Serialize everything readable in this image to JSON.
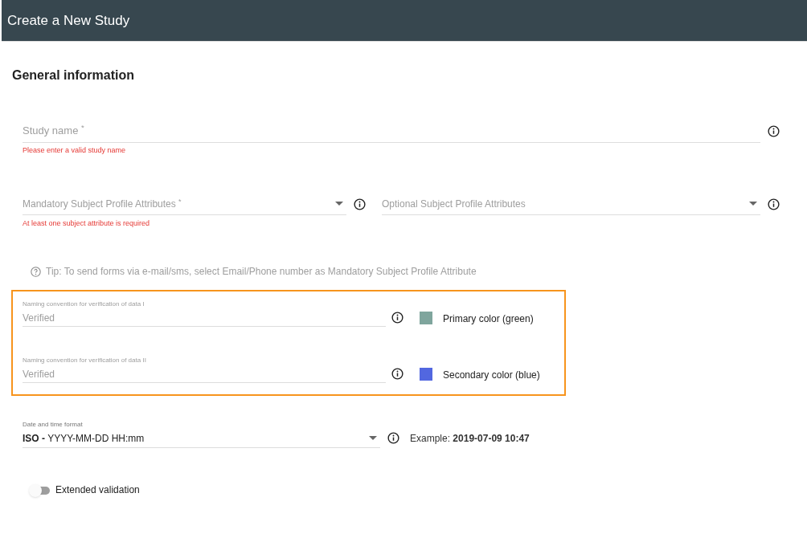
{
  "header": {
    "title": "Create a New Study"
  },
  "section_title": "General information",
  "study_name": {
    "placeholder": "Study name $^{*}$",
    "error": "Please enter a valid study name"
  },
  "mandatory_attributes": {
    "placeholder": "Mandatory Subject Profile Attributes $^{*}$",
    "error": "At least one subject attribute is required"
  },
  "optional_attributes": {
    "placeholder": "Optional Subject Profile Attributes"
  },
  "tip": "Tip: To send forms via e-mail/sms, select Email/Phone number as Mandatory Subject Profile Attribute",
  "verification_fields": [
    {
      "label": "Naming convention for verification of data I",
      "placeholder": "Verified",
      "color": "#7fa59d",
      "color_label": "Primary color (green)"
    },
    {
      "label": "Naming convention for verification of data II",
      "placeholder": "Verified",
      "color": "#5267e0",
      "color_label": "Secondary color (blue)"
    }
  ],
  "date_format": {
    "label": "Date and time format",
    "value": "**ISO -** YYYY-MM-DD HH:mm",
    "example": "Example: **2019-07-09 10:47**"
  },
  "extended_validation": {
    "label": "Extended validation",
    "on": false
  }
}
